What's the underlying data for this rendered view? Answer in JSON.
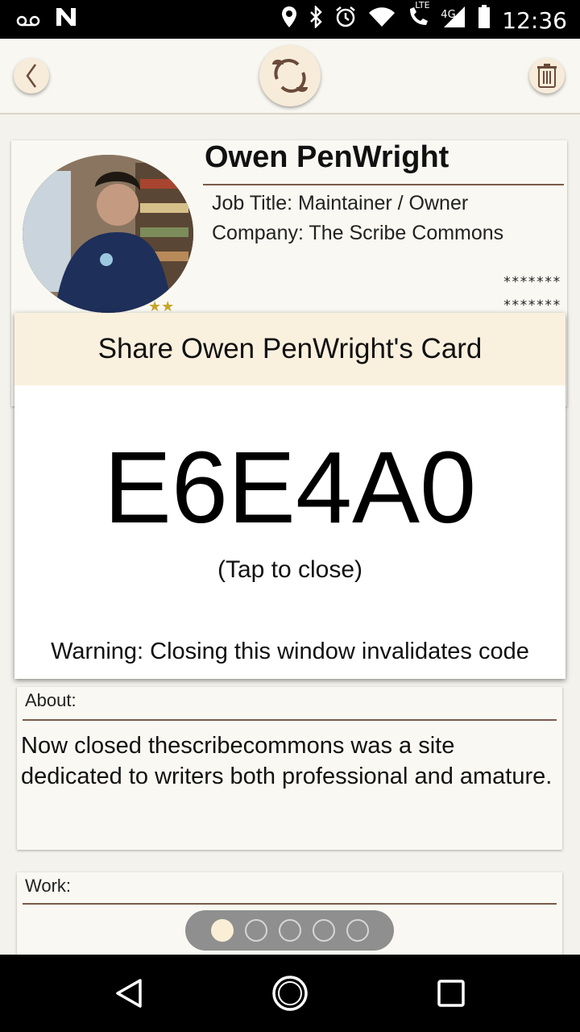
{
  "statusbar": {
    "time": "12:36",
    "network_label": "LTE",
    "signal_label": "4G",
    "icons": [
      "voicemail-icon",
      "n-app-icon",
      "location-icon",
      "bluetooth-icon",
      "alarm-icon",
      "wifi-icon",
      "lte-call-icon",
      "cell-signal-icon",
      "battery-icon"
    ]
  },
  "topbar": {
    "back_icon": "chevron-left-icon",
    "sync_icon": "sync-icon",
    "trash_icon": "trash-icon"
  },
  "profile": {
    "name": "Owen PenWright",
    "job_title": "Job Title: Maintainer / Owner",
    "company": "Company: The Scribe Commons",
    "masked_1": "*******",
    "masked_2": "*******"
  },
  "share_dialog": {
    "title": "Share Owen PenWright's Card",
    "code": "E6E4A0",
    "tap_hint": "(Tap to close)",
    "warning": "Warning: Closing this window invalidates code"
  },
  "about": {
    "label": "About:",
    "text": "Now closed thescribecommons was a site dedicated to writers both professional and amature."
  },
  "work": {
    "label": "Work:"
  },
  "pager": {
    "page_count": 5,
    "active_index": 0
  },
  "colors": {
    "accent_brown": "#7a5a4a",
    "dialog_header": "#faf0de",
    "card_bg": "#f9f8f2"
  }
}
